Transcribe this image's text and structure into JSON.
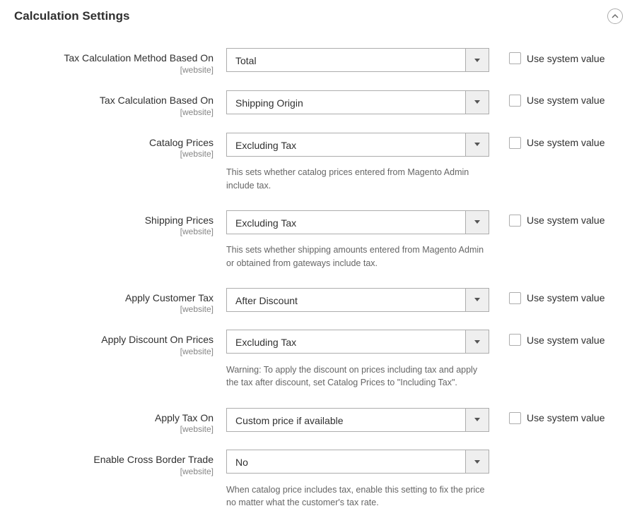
{
  "section": {
    "title": "Calculation Settings"
  },
  "system_value_label": "Use system value",
  "fields": [
    {
      "label": "Tax Calculation Method Based On",
      "scope": "[website]",
      "value": "Total",
      "showSystem": true,
      "note": null
    },
    {
      "label": "Tax Calculation Based On",
      "scope": "[website]",
      "value": "Shipping Origin",
      "showSystem": true,
      "note": null
    },
    {
      "label": "Catalog Prices",
      "scope": "[website]",
      "value": "Excluding Tax",
      "showSystem": true,
      "note": "This sets whether catalog prices entered from Magento Admin include tax."
    },
    {
      "label": "Shipping Prices",
      "scope": "[website]",
      "value": "Excluding Tax",
      "showSystem": true,
      "note": "This sets whether shipping amounts entered from Magento Admin or obtained from gateways include tax."
    },
    {
      "label": "Apply Customer Tax",
      "scope": "[website]",
      "value": "After Discount",
      "showSystem": true,
      "note": null
    },
    {
      "label": "Apply Discount On Prices",
      "scope": "[website]",
      "value": "Excluding Tax",
      "showSystem": true,
      "note": "Warning: To apply the discount on prices including tax and apply the tax after discount, set Catalog Prices to \"Including Tax\"."
    },
    {
      "label": "Apply Tax On",
      "scope": "[website]",
      "value": "Custom price if available",
      "showSystem": true,
      "note": null
    },
    {
      "label": "Enable Cross Border Trade",
      "scope": "[website]",
      "value": "No",
      "showSystem": false,
      "note": "When catalog price includes tax, enable this setting to fix the price no matter what the customer's tax rate."
    }
  ]
}
